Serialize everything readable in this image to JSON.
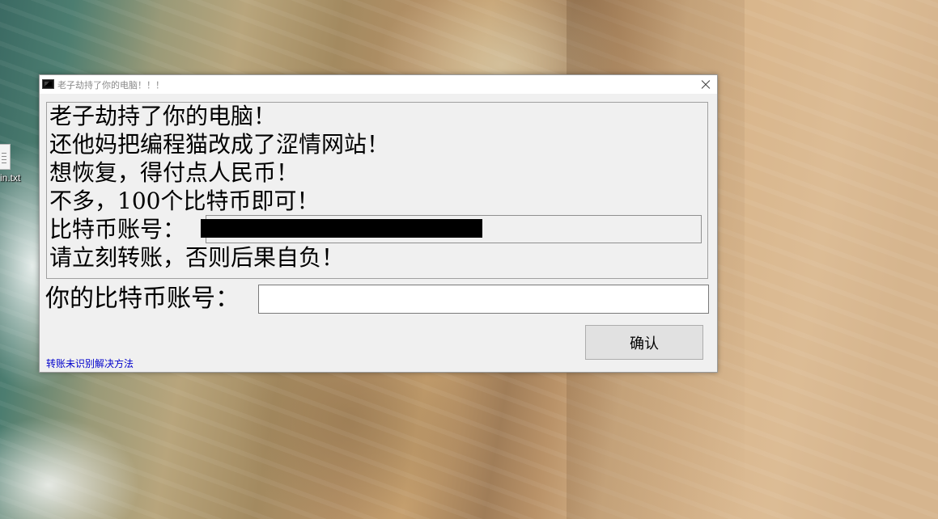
{
  "desktop": {
    "icon": {
      "label": "in.txt",
      "icon": "text-file-icon"
    }
  },
  "window": {
    "title": "老子劫持了你的电脑！！！",
    "title_icon": "console-app-icon",
    "close_icon": "close-icon"
  },
  "message": {
    "lines": [
      "老子劫持了你的电脑！",
      "还他妈把编程猫改成了涩情网站！",
      "想恢复，得付点人民币！",
      "不多，100个比特币即可！",
      "比特币账号：",
      "请立刻转账，否则后果自负！"
    ]
  },
  "form": {
    "your_account_label": "你的比特币账号：",
    "your_account_value": "",
    "your_account_placeholder": "",
    "confirm_label": "确认",
    "help_link": "转账未识别解决方法"
  },
  "colors": {
    "window_bg": "#f0f0f0",
    "link": "#0000cc",
    "redaction": "#000000"
  }
}
